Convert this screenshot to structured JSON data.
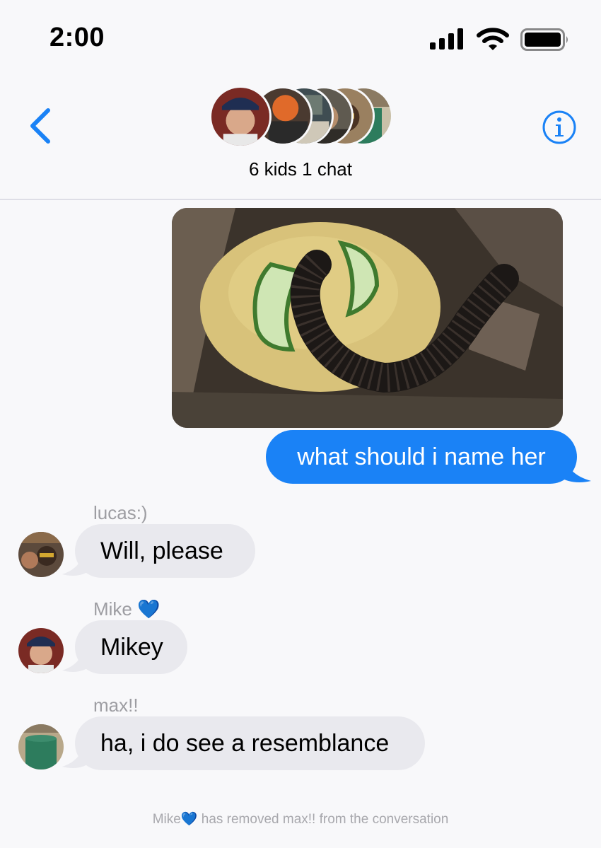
{
  "status_bar": {
    "time": "2:00"
  },
  "header": {
    "chat_name": "6 kids 1 chat",
    "back_icon": "chevron-left-icon",
    "info_icon": "info-circle-icon"
  },
  "messages": {
    "outgoing_text": "what should i name her",
    "incoming": [
      {
        "sender": "lucas:)",
        "text": "Will, please"
      },
      {
        "sender": "Mike 💙",
        "text": "Mikey"
      },
      {
        "sender": "max!!",
        "text": "ha, i do see a resemblance"
      }
    ]
  },
  "system_note": "Mike💙 has removed max!! from the conversation",
  "colors": {
    "accent": "#1a82f6",
    "bubble_in": "#e9e9ee",
    "background": "#f8f8fa",
    "secondary_text": "#9d9da2"
  }
}
